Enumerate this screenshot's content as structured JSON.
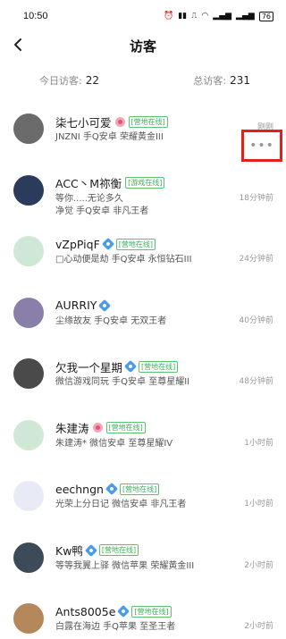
{
  "status": {
    "time": "10:50",
    "battery": "76"
  },
  "nav": {
    "title": "访客"
  },
  "stats": {
    "today_label": "今日访客:",
    "today_count": "22",
    "total_label": "总访客:",
    "total_count": "231"
  },
  "more_menu_label": "•••",
  "visitors": [
    {
      "name": "柒七小可爱",
      "gender": "female",
      "online": "[营地在线]",
      "line1": "JNZNI 手Q安卓 荣耀黄金III",
      "line2": "",
      "time": "刚刚",
      "avatar": "#6b6b6b"
    },
    {
      "name": "ACC丶M祢衡",
      "gender": "",
      "online": "[游戏在线]",
      "line1": "等你.....无论多久",
      "line2": "净觉   手Q安卓 非凡王者",
      "time": "18分钟前",
      "avatar": "#2a3b5c"
    },
    {
      "name": "vZpPiqF",
      "gender": "male",
      "online": "[营地在线]",
      "line1": "□心动便是劫 手Q安卓 永恒钻石III",
      "line2": "",
      "time": "24分钟前",
      "avatar": "#cfe8d6"
    },
    {
      "name": "AURRIY",
      "gender": "male",
      "online": "",
      "line1": "尘缘故友 手Q安卓 无双王者",
      "line2": "",
      "time": "40分钟前",
      "avatar": "#8a7fa8"
    },
    {
      "name": "欠我一个星期",
      "gender": "male",
      "online": "[营地在线]",
      "line1": "微信游戏同玩 手Q安卓 至尊星耀II",
      "line2": "",
      "time": "48分钟前",
      "avatar": "#4a4a4a"
    },
    {
      "name": "朱建涛",
      "gender": "female",
      "online": "[营地在线]",
      "line1": "朱建涛* 微信安卓 至尊星耀IV",
      "line2": "",
      "time": "1小时前",
      "avatar": "#cfe8d6"
    },
    {
      "name": "eechngn",
      "gender": "male",
      "online": "[营地在线]",
      "line1": "光荣上分日记 微信安卓 非凡王者",
      "line2": "",
      "time": "1小时前",
      "avatar": "#e8ebf5"
    },
    {
      "name": "Kw鸭",
      "gender": "male",
      "online": "[营地在线]",
      "line1": "等等我翼上驿 微信苹果 荣耀黄金III",
      "line2": "",
      "time": "2小时前",
      "avatar": "#3c4a5a"
    },
    {
      "name": "Ants8005e",
      "gender": "male",
      "online": "[营地在线]",
      "line1": "白露在海边 手Q苹果 至圣王者",
      "line2": "",
      "time": "2小时前",
      "avatar": "#b4885a"
    }
  ],
  "icons": {
    "back": "chevron-left-icon",
    "more": "more-dots-icon"
  }
}
